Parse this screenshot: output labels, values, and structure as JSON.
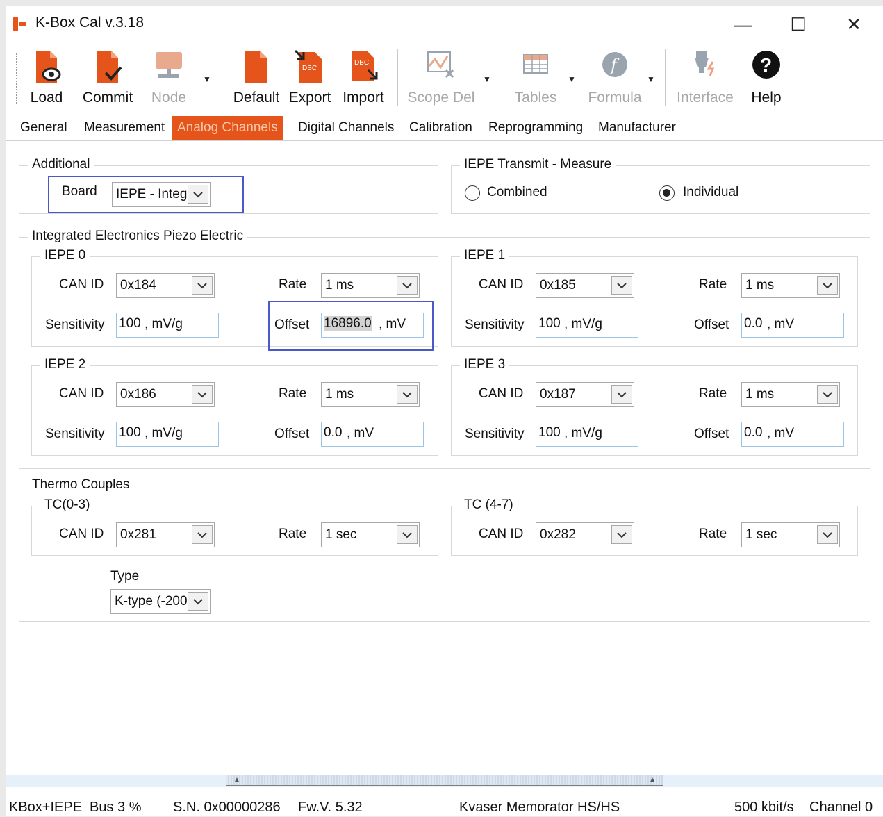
{
  "window": {
    "title": "K-Box Cal v.3.18",
    "minimize": "—",
    "maximize": "☐",
    "close": "✕"
  },
  "toolbar": {
    "load": "Load",
    "commit": "Commit",
    "node": "Node",
    "default": "Default",
    "export": "Export",
    "import": "Import",
    "scope_del": "Scope Del",
    "tables": "Tables",
    "formula": "Formula",
    "interface": "Interface",
    "help": "Help",
    "dbc_badge": "DBC"
  },
  "tabs": [
    "General",
    "Measurement",
    "Analog Channels",
    "Digital Channels",
    "Calibration",
    "Reprogramming",
    "Manufacturer"
  ],
  "active_tab": "Analog Channels",
  "additional": {
    "title": "Additional",
    "board_label": "Board",
    "board_value": "IEPE - Integ"
  },
  "iepe_transmit": {
    "title": "IEPE Transmit - Measure",
    "combined": "Combined",
    "individual": "Individual",
    "selected": "Individual"
  },
  "iepe": {
    "title": "Integrated Electronics Piezo Electric",
    "can_id_label": "CAN ID",
    "rate_label": "Rate",
    "sensitivity_label": "Sensitivity",
    "offset_label": "Offset",
    "sensitivity_unit": ", mV/g",
    "offset_unit": ", mV",
    "channels": [
      {
        "title": "IEPE 0",
        "can_id": "0x184",
        "rate": "1 ms",
        "sensitivity": "100",
        "offset": "16896.0"
      },
      {
        "title": "IEPE 1",
        "can_id": "0x185",
        "rate": "1 ms",
        "sensitivity": "100",
        "offset": "0.0"
      },
      {
        "title": "IEPE 2",
        "can_id": "0x186",
        "rate": "1 ms",
        "sensitivity": "100",
        "offset": "0.0"
      },
      {
        "title": "IEPE 3",
        "can_id": "0x187",
        "rate": "1 ms",
        "sensitivity": "100",
        "offset": "0.0"
      }
    ]
  },
  "thermo": {
    "title": "Thermo Couples",
    "can_id_label": "CAN ID",
    "rate_label": "Rate",
    "groups": [
      {
        "title": "TC(0-3)",
        "can_id": "0x281",
        "rate": "1 sec"
      },
      {
        "title": "TC (4-7)",
        "can_id": "0x282",
        "rate": "1 sec"
      }
    ],
    "type_label": "Type",
    "type_value": "K-type (-200"
  },
  "status": {
    "device": "KBox+IEPE",
    "bus": "Bus 3 %",
    "serial": "S.N. 0x00000286",
    "firmware": "Fw.V. 5.32",
    "interface": "Kvaser Memorator HS/HS",
    "bitrate": "500 kbit/s",
    "channel": "Channel 0"
  },
  "colors": {
    "accent": "#e4541b",
    "focus_outline": "#4a58c8",
    "input_border": "#9cc4e4"
  },
  "icons": [
    "load-icon",
    "commit-icon",
    "node-icon",
    "default-icon",
    "export-icon",
    "import-icon",
    "scope-del-icon",
    "tables-icon",
    "formula-icon",
    "interface-icon",
    "help-icon"
  ]
}
